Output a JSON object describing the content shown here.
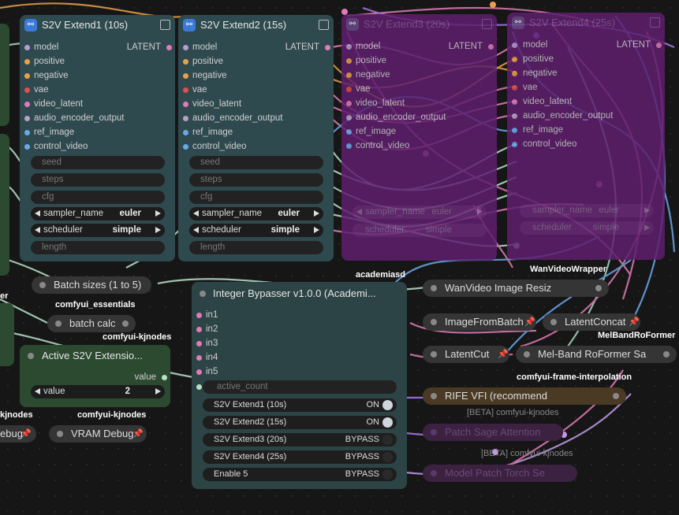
{
  "nodes": {
    "ext1": {
      "title": "S2V Extend1 (10s)",
      "out": "LATENT"
    },
    "ext2": {
      "title": "S2V Extend2 (15s)",
      "out": "LATENT"
    },
    "ext3": {
      "title": "S2V Extend3 (20s)",
      "out": "LATENT"
    },
    "ext4": {
      "title": "S2V Extend4 (25s)",
      "out": "LATENT"
    },
    "inputs": [
      "model",
      "positive",
      "negative",
      "vae",
      "video_latent",
      "audio_encoder_output",
      "ref_image",
      "control_video"
    ],
    "widgets": [
      "seed",
      "steps",
      "cfg"
    ],
    "sampler": {
      "label": "sampler_name",
      "value": "euler"
    },
    "scheduler": {
      "label": "scheduler",
      "value": "simple"
    },
    "length": "length",
    "batch_sizes": "Batch sizes (1 to 5)",
    "batch_calc": "batch calc",
    "active_ext": {
      "title": "Active S2V Extensio...",
      "out": "value",
      "widget_label": "value",
      "widget_value": "2"
    },
    "vram_debug": "VRAM Debug",
    "debug_partial": "ebug",
    "bypasser": {
      "title": "Integer Bypasser v1.0.0 (Academi...",
      "inputs": [
        "in1",
        "in2",
        "in3",
        "in4",
        "in5"
      ],
      "active_count": "active_count",
      "toggles": [
        {
          "label": "S2V Extend1 (10s)",
          "state": "ON"
        },
        {
          "label": "S2V Extend2 (15s)",
          "state": "ON"
        },
        {
          "label": "S2V Extend3 (20s)",
          "state": "BYPASS"
        },
        {
          "label": "S2V Extend4 (25s)",
          "state": "BYPASS"
        },
        {
          "label": "Enable 5",
          "state": "BYPASS"
        }
      ]
    },
    "wan_resize": "WanVideo Image Resiz",
    "image_from_batch": "ImageFromBatch",
    "latent_concat": "LatentConcat",
    "latent_cut": "LatentCut",
    "melband": "Mel-Band RoFormer Sa",
    "rife": "RIFE VFI (recommend",
    "patch_sage": "Patch Sage Attention",
    "model_patch": "Model Patch Torch Se"
  },
  "tags": {
    "academiasd": "academiasd",
    "wanvideowrapper": "WanVideoWrapper",
    "comfyui_essentials": "comfyui_essentials",
    "comfyui_kjnodes_1": "comfyui-kjnodes",
    "comfyui_kjnodes_2": "comfyui-kjnodes",
    "kjnodes_partial": "kjnodes",
    "melbandroformer": "MelBandRoFormer",
    "frame_interp": "comfyui-frame-interpolation",
    "beta1": "[BETA] comfyui-kjnodes",
    "beta2": "[BETA] comfyui-kjnodes",
    "er_partial": "er"
  },
  "colors": {
    "canvas": "#161616",
    "teal_node": "#2f4a4f",
    "purple_node": "#5e1f6e",
    "green_node": "#2c4a30",
    "brown_node": "#4a3a24",
    "on_knob": "#cfd6dc",
    "bypass_knob": "#2a2a2a"
  }
}
